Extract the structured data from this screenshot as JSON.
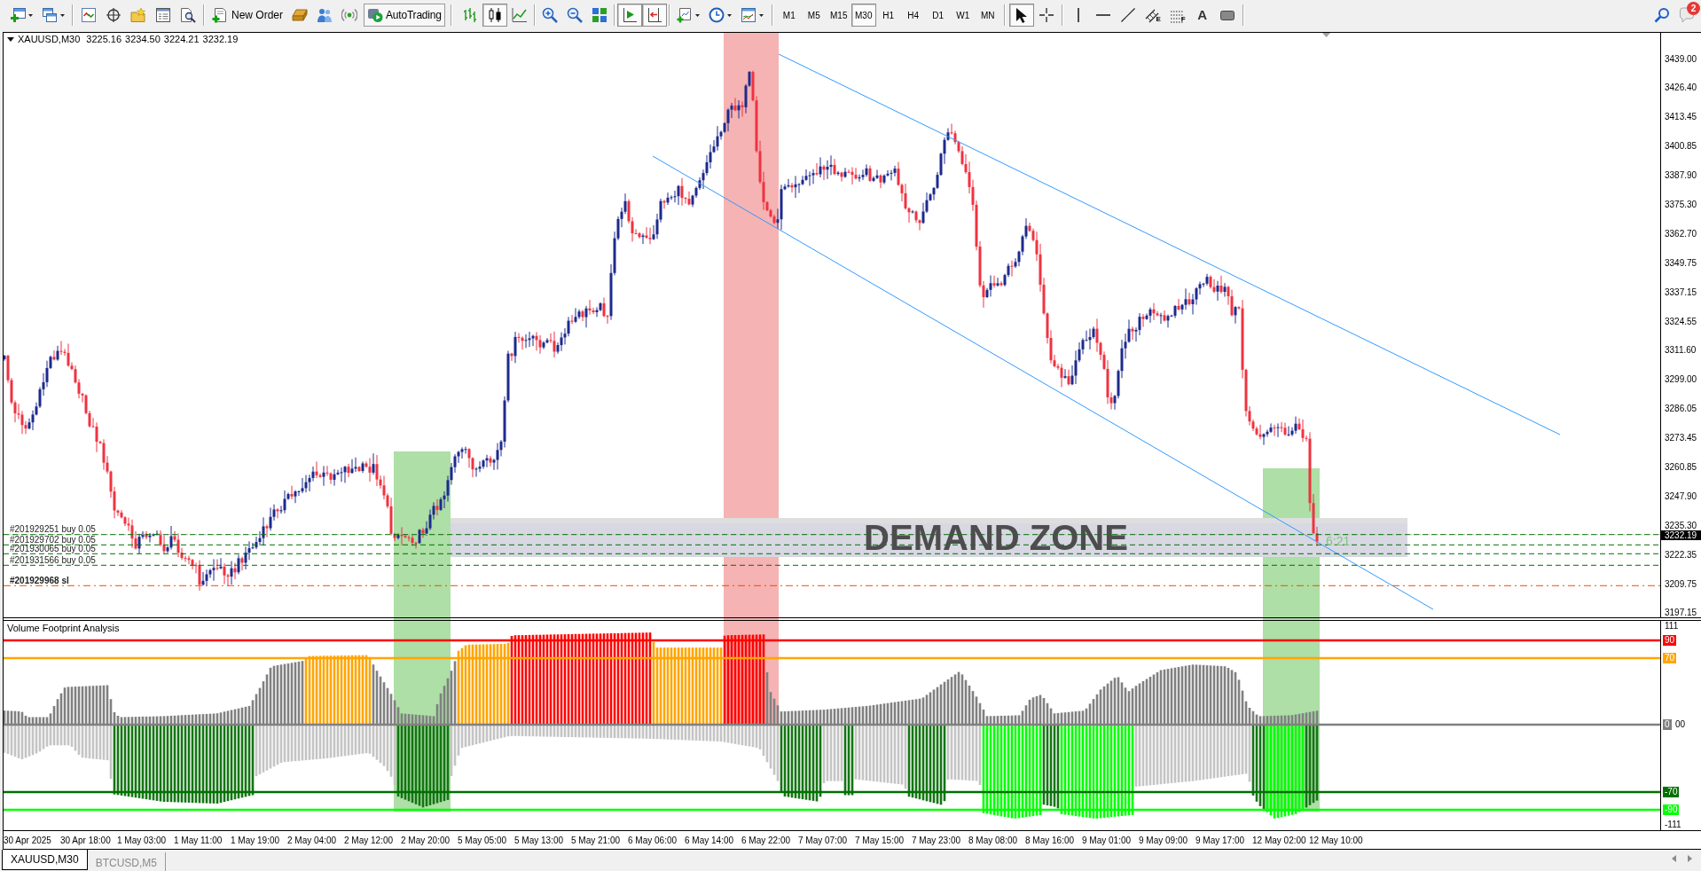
{
  "toolbar": {
    "new_order": "New Order",
    "autotrading": {
      "label": "AutoTrading",
      "on": true
    },
    "chart_types": [
      {
        "selected": false
      },
      {
        "selected": true
      },
      {
        "selected": false
      }
    ],
    "scroll_toggles": [
      {
        "on": true
      },
      {
        "on": true
      }
    ],
    "timeframes": [
      {
        "label": "M1",
        "selected": false
      },
      {
        "label": "M5",
        "selected": false
      },
      {
        "label": "M15",
        "selected": false
      },
      {
        "label": "M30",
        "selected": true
      },
      {
        "label": "H1",
        "selected": false
      },
      {
        "label": "H4",
        "selected": false
      },
      {
        "label": "D1",
        "selected": false
      },
      {
        "label": "W1",
        "selected": false
      },
      {
        "label": "MN",
        "selected": false
      }
    ],
    "cursor_tools": [
      {
        "selected": true
      },
      {
        "selected": false
      }
    ],
    "study_letters": [
      "E",
      "F",
      "A"
    ],
    "notification_count": "2"
  },
  "chart_window": {
    "highlight_zones": [
      {
        "color": "#addfa6"
      },
      {
        "color": "#f5b3b3"
      },
      {
        "color": "#addfa6"
      }
    ],
    "main_chart": {
      "symbol": "XAUUSD,M30",
      "quotes": [
        "3225.16",
        "3234.50",
        "3224.21",
        "3232.19"
      ],
      "demand_zone": "DEMAND ZONE",
      "bar_countdown": "6:21",
      "orders": [
        "#201929251 buy 0.05",
        "#201929702 buy 0.05",
        "#201930065 buy 0.05",
        "#201931566 buy 0.05"
      ],
      "stop_loss": "#201929968 sl",
      "price_axis": [
        "3439.00",
        "3426.40",
        "3413.45",
        "3400.85",
        "3387.90",
        "3375.30",
        "3362.70",
        "3349.75",
        "3337.15",
        "3324.55",
        "3311.60",
        "3299.00",
        "3286.05",
        "3273.45",
        "3260.85",
        "3247.90",
        "3235.30",
        "3222.35",
        "3209.75",
        "3197.15"
      ],
      "current_price": "3232.19"
    },
    "indicator": {
      "title": "Volume Footprint Analysis",
      "scale_max": "111",
      "levels": [
        {
          "label": "90",
          "color": "#ff0000"
        },
        {
          "label": "70",
          "color": "#ffa500"
        },
        {
          "label": "0",
          "color": "#808080"
        },
        {
          "label": "-70",
          "color": "#007000"
        },
        {
          "label": "-90",
          "color": "#00ff00"
        }
      ],
      "value_tail": "00",
      "scale_min": "-111"
    },
    "time_axis": [
      "30 Apr 2025",
      "30 Apr 18:00",
      "1 May 03:00",
      "1 May 11:00",
      "1 May 19:00",
      "2 May 04:00",
      "2 May 12:00",
      "2 May 20:00",
      "5 May 05:00",
      "5 May 13:00",
      "5 May 21:00",
      "6 May 06:00",
      "6 May 14:00",
      "6 May 22:00",
      "7 May 07:00",
      "7 May 15:00",
      "7 May 23:00",
      "8 May 08:00",
      "8 May 16:00",
      "9 May 01:00",
      "9 May 09:00",
      "9 May 17:00",
      "12 May 02:00",
      "12 May 10:00"
    ]
  },
  "tabs": [
    {
      "label": "XAUUSD,M30",
      "selected": true
    },
    {
      "label": "BTCUSD,M5",
      "selected": false
    }
  ]
}
